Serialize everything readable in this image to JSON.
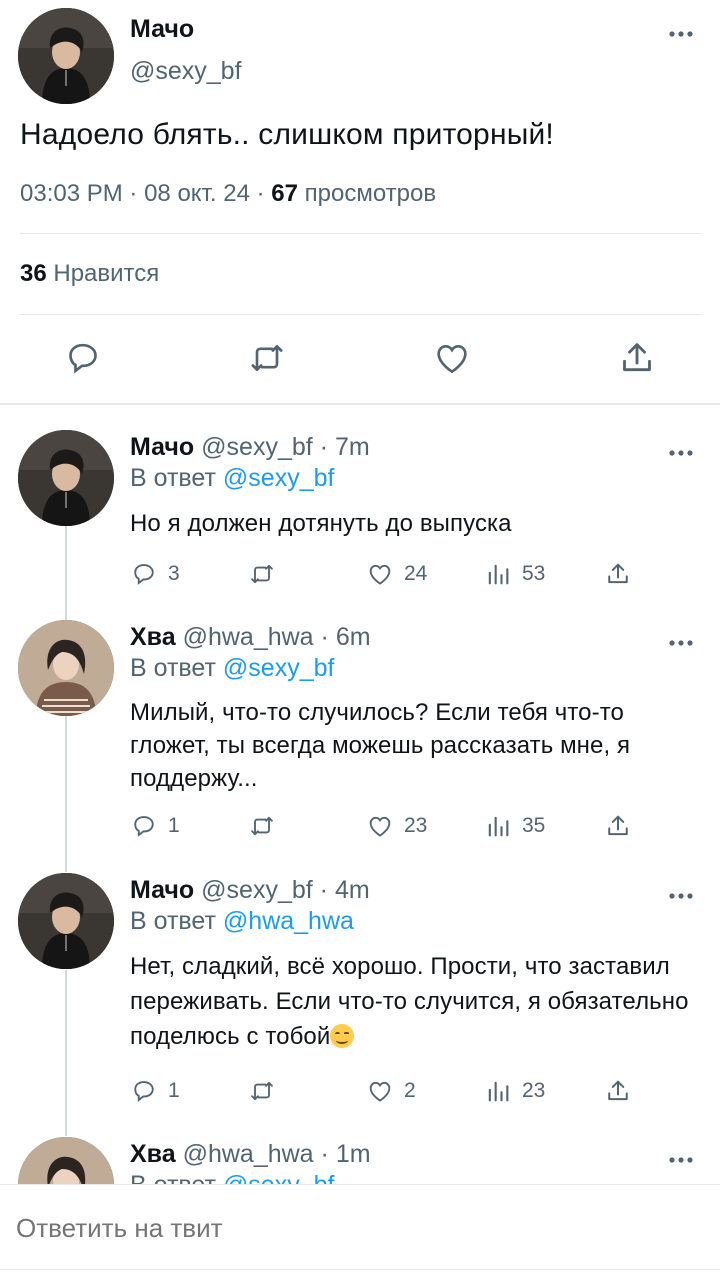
{
  "main_tweet": {
    "author_name": "Мачо",
    "author_handle": "@sexy_bf",
    "text": "Надоело блять.. слишком приторный!",
    "time": "03:03 PM",
    "date": "08 окт. 24",
    "views_count": "67",
    "views_label": "просмотров",
    "likes_count": "36",
    "likes_label": "Нравится"
  },
  "in_reply_label": "В ответ",
  "replies": [
    {
      "name": "Мачо",
      "handle": "@sexy_bf",
      "time": "7m",
      "reply_to": "@sexy_bf",
      "text": "Но я должен дотянуть до выпуска",
      "replies": "3",
      "likes": "24",
      "views": "53"
    },
    {
      "name": "Хва",
      "handle": "@hwa_hwa",
      "time": "6m",
      "reply_to": "@sexy_bf",
      "text": "Милый, что-то случилось? Если тебя что-то гложет, ты всегда можешь рассказать мне, я поддержу...",
      "replies": "1",
      "likes": "23",
      "views": "35"
    },
    {
      "name": "Мачо",
      "handle": "@sexy_bf",
      "time": "4m",
      "reply_to": "@hwa_hwa",
      "text": "Нет, сладкий, всё хорошо. Прости, что заставил переживать. Если что-то случится, я обязательно поделюсь с тобой",
      "replies": "1",
      "likes": "2",
      "views": "23"
    },
    {
      "name": "Хва",
      "handle": "@hwa_hwa",
      "time": "1m",
      "reply_to": "@sexy_bf"
    }
  ],
  "compose": {
    "placeholder": "Ответить на твит"
  },
  "icons": {
    "reply": "reply-icon",
    "retweet": "retweet-icon",
    "like": "heart-icon",
    "views": "views-icon",
    "share": "share-icon",
    "more": "more-icon",
    "emoji": "smiling-face-emoji"
  },
  "colors": {
    "link": "#1d9bf0",
    "muted": "#536471",
    "text": "#0f1419"
  }
}
